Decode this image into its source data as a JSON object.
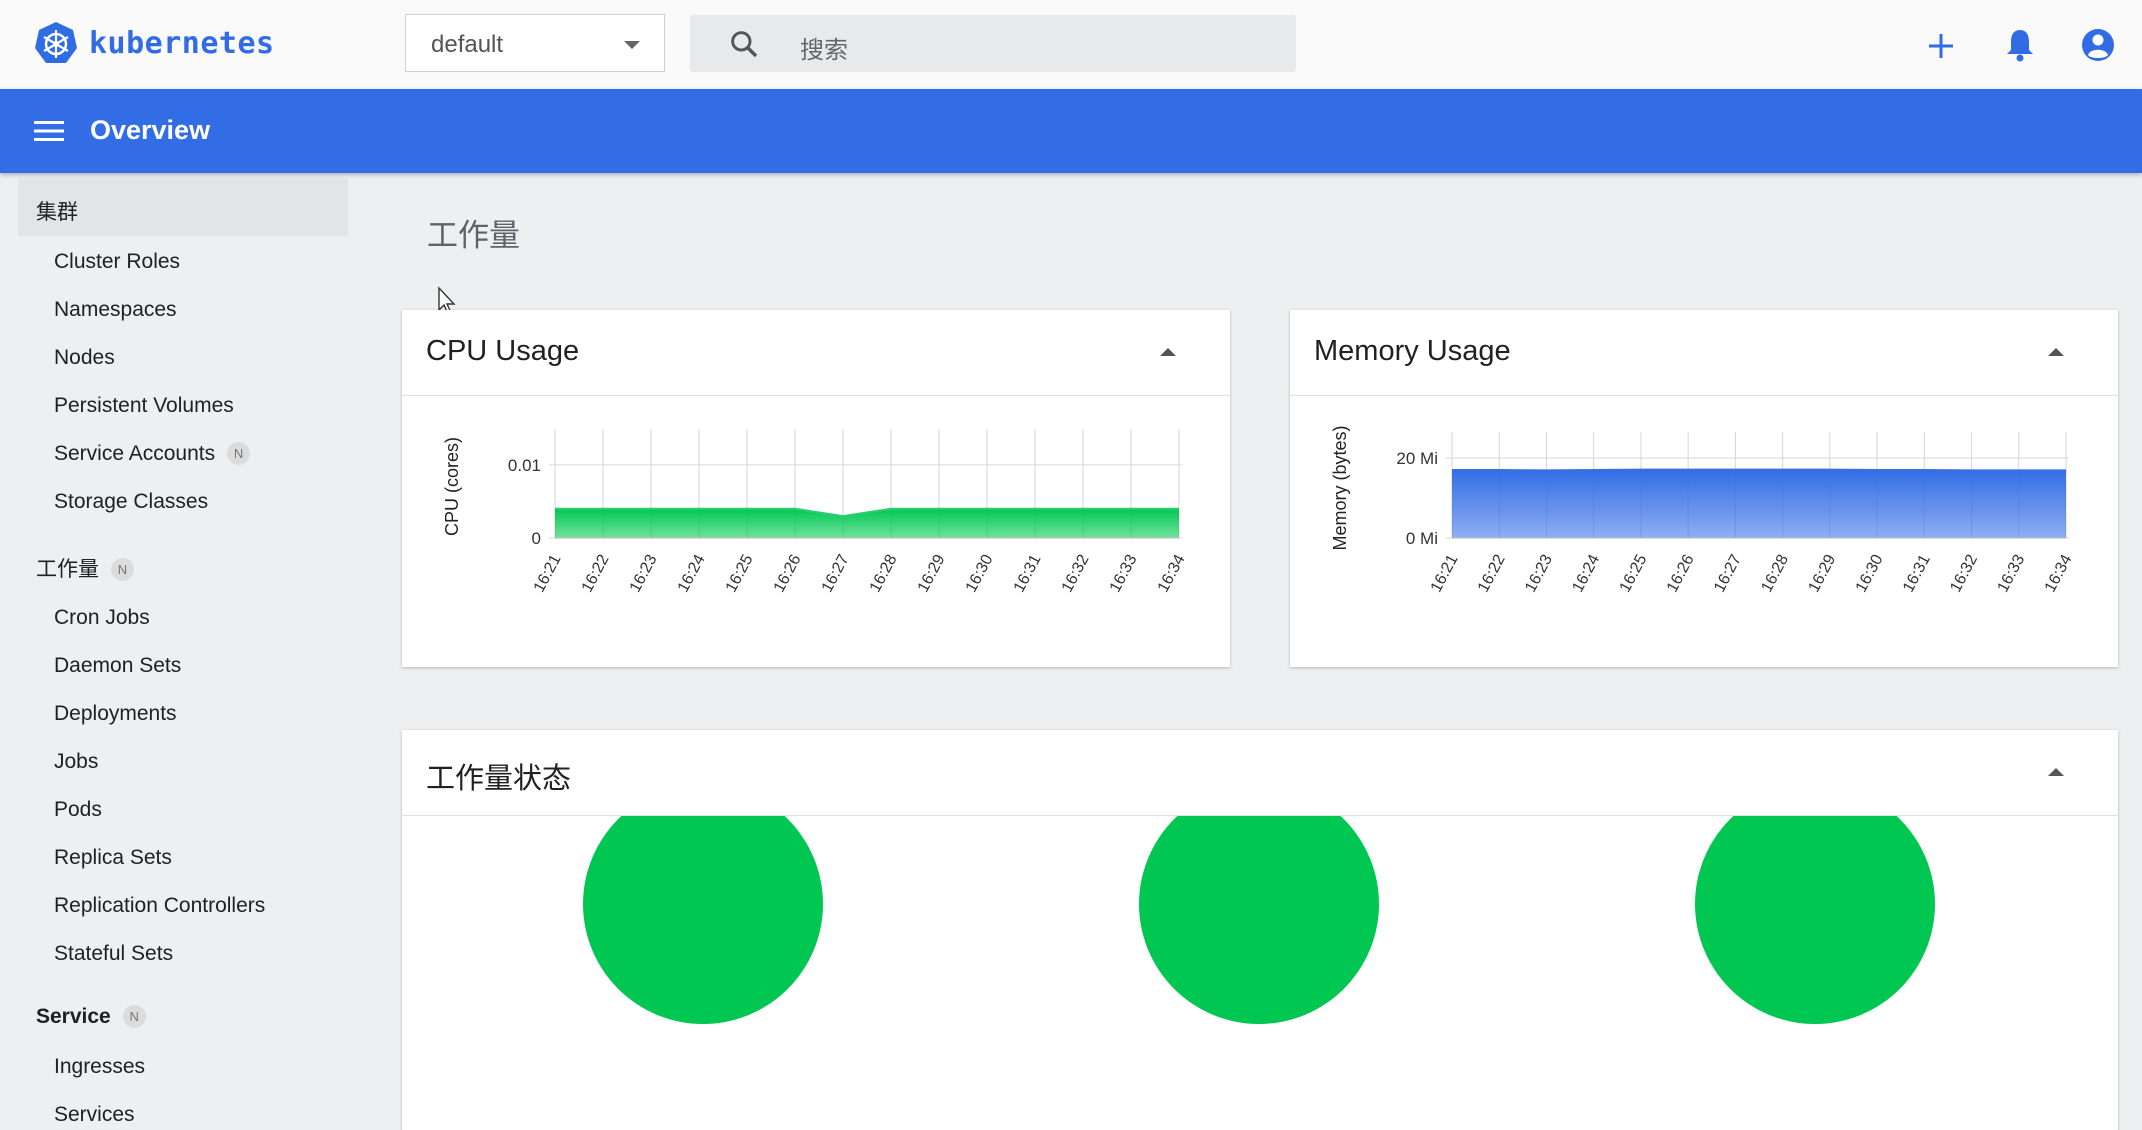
{
  "app": {
    "name": "kubernetes"
  },
  "namespace_select": {
    "value": "default"
  },
  "search": {
    "placeholder": "搜索"
  },
  "header": {
    "title": "Overview"
  },
  "sidebar": {
    "cluster": {
      "label": "集群",
      "items": [
        "Cluster Roles",
        "Namespaces",
        "Nodes",
        "Persistent Volumes",
        "Service Accounts",
        "Storage Classes"
      ],
      "badge_item": "Service Accounts"
    },
    "workloads": {
      "label": "工作量",
      "badge": "N",
      "items": [
        "Cron Jobs",
        "Daemon Sets",
        "Deployments",
        "Jobs",
        "Pods",
        "Replica Sets",
        "Replication Controllers",
        "Stateful Sets"
      ]
    },
    "service": {
      "label": "Service",
      "badge": "N",
      "items": [
        "Ingresses",
        "Services"
      ]
    },
    "item_badge": "N"
  },
  "main": {
    "section_title": "工作量",
    "cpu_card": {
      "title": "CPU Usage"
    },
    "memory_card": {
      "title": "Memory Usage"
    },
    "status_card": {
      "title": "工作量状态"
    }
  },
  "colors": {
    "brand": "#326ce5",
    "header": "#326de6",
    "cpu_fill": "#00c853",
    "mem_fill": "#326de6",
    "status_ok": "#00c752"
  },
  "icons": [
    "kubernetes-logo-icon",
    "chevron-down-icon",
    "search-icon",
    "plus-icon",
    "bell-icon",
    "account-icon",
    "menu-icon",
    "collapse-icon"
  ],
  "chart_data": [
    {
      "type": "area",
      "ylabel": "CPU (cores)",
      "x": [
        "16:21",
        "16:22",
        "16:23",
        "16:24",
        "16:25",
        "16:26",
        "16:27",
        "16:28",
        "16:29",
        "16:30",
        "16:31",
        "16:32",
        "16:33",
        "16:34"
      ],
      "yticks": [
        "0",
        "0.01"
      ],
      "ylim": [
        0,
        0.013
      ],
      "series": [
        {
          "values": [
            0.004,
            0.004,
            0.004,
            0.004,
            0.004,
            0.004,
            0.003,
            0.004,
            0.004,
            0.004,
            0.004,
            0.004,
            0.004,
            0.004
          ]
        }
      ]
    },
    {
      "type": "area",
      "ylabel": "Memory (bytes)",
      "x": [
        "16:21",
        "16:22",
        "16:23",
        "16:24",
        "16:25",
        "16:26",
        "16:27",
        "16:28",
        "16:29",
        "16:30",
        "16:31",
        "16:32",
        "16:33",
        "16:34"
      ],
      "yticks": [
        "0 Mi",
        "20 Mi"
      ],
      "ylim": [
        0,
        23
      ],
      "series": [
        {
          "values": [
            17,
            17,
            16.9,
            17,
            17.1,
            17.1,
            17.1,
            17.1,
            17.1,
            17,
            17,
            16.9,
            16.9,
            16.9
          ]
        }
      ]
    },
    {
      "type": "pie",
      "values": [
        1,
        1,
        1
      ]
    }
  ]
}
